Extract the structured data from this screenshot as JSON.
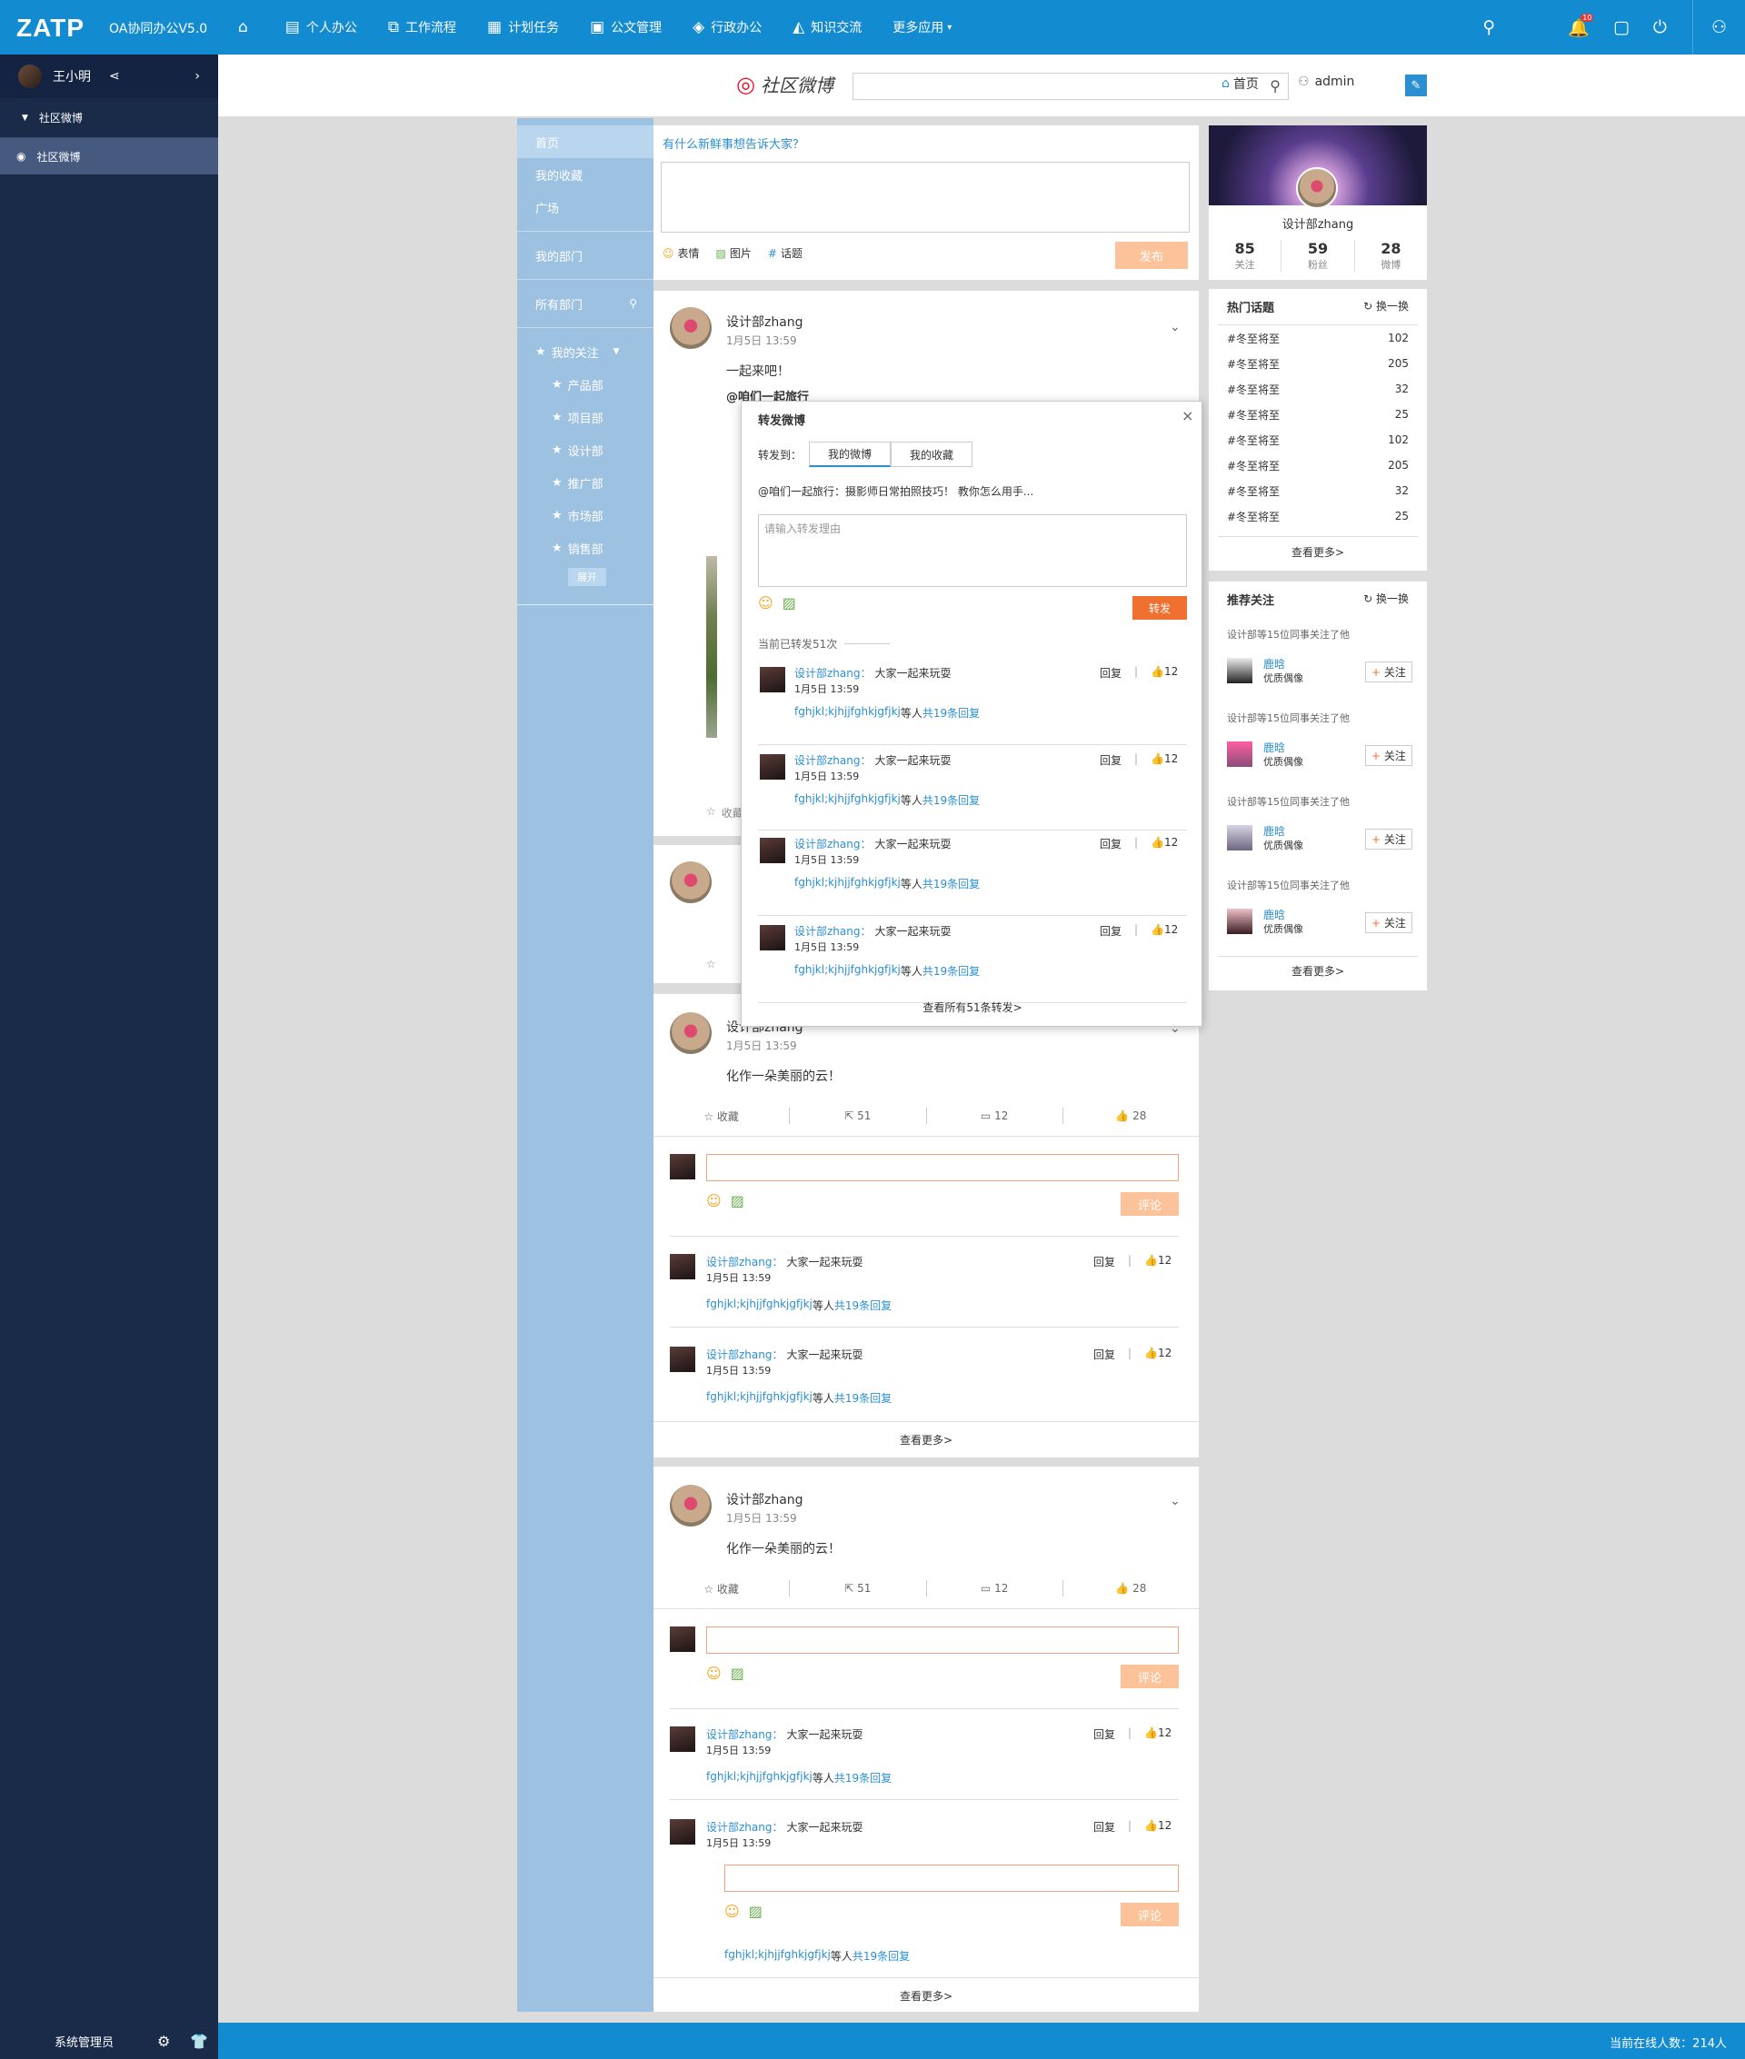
{
  "topbar": {
    "logo": "ZATP",
    "app_name": "OA协同办公V5.0",
    "nav": [
      {
        "label": "个人办公",
        "icon": "document-icon"
      },
      {
        "label": "工作流程",
        "icon": "flow-icon"
      },
      {
        "label": "计划任务",
        "icon": "task-icon"
      },
      {
        "label": "公文管理",
        "icon": "archive-icon"
      },
      {
        "label": "行政办公",
        "icon": "layers-icon"
      },
      {
        "label": "知识交流",
        "icon": "graduation-icon"
      }
    ],
    "more_apps": "更多应用",
    "notif_count": "10"
  },
  "sidebar": {
    "user_name": "王小明",
    "group": "社区微博",
    "item": "社区微博",
    "footer": "系统管理员"
  },
  "header": {
    "brand": "社区微博",
    "search_placeholder": "",
    "home": "首页",
    "user": "admin"
  },
  "leftnav": {
    "items": [
      "首页",
      "我的收藏",
      "广场"
    ],
    "my_dept": "我的部门",
    "all_dept": "所有部门",
    "my_follow": "我的关注",
    "sub_items": [
      "产品部",
      "项目部",
      "设计部",
      "推广部",
      "市场部",
      "销售部"
    ],
    "expand": "展开"
  },
  "composer": {
    "prompt": "有什么新鲜事想告诉大家？",
    "emoji": "表情",
    "image": "图片",
    "topic": "话题",
    "publish": "发布"
  },
  "profile": {
    "name": "设计部zhang",
    "stats": [
      {
        "value": "85",
        "label": "关注"
      },
      {
        "value": "59",
        "label": "粉丝"
      },
      {
        "value": "28",
        "label": "微博"
      }
    ]
  },
  "hot_topics": {
    "title": "热门话题",
    "refresh": "换一换",
    "items": [
      {
        "name": "#冬至将至",
        "count": "102"
      },
      {
        "name": "#冬至将至",
        "count": "205"
      },
      {
        "name": "#冬至将至",
        "count": "32"
      },
      {
        "name": "#冬至将至",
        "count": "25"
      },
      {
        "name": "#冬至将至",
        "count": "102"
      },
      {
        "name": "#冬至将至",
        "count": "205"
      },
      {
        "name": "#冬至将至",
        "count": "32"
      },
      {
        "name": "#冬至将至",
        "count": "25"
      }
    ],
    "more": "查看更多>"
  },
  "recommend": {
    "title": "推荐关注",
    "refresh": "换一换",
    "reason": "设计部等15位同事关注了他",
    "name": "鹿晗",
    "desc": "优质偶像",
    "follow": "关注",
    "more": "查看更多>"
  },
  "post1": {
    "author": "设计部zhang",
    "time": "1月5日  13:59",
    "text": "一起来吧！",
    "mention": "@咱们一起旅行",
    "fav": "收藏"
  },
  "post2": {
    "author": "设计部zhang",
    "time": "1月5日  13:59",
    "text": "化作一朵美丽的云！",
    "fav": "收藏",
    "share": "51",
    "comment": "12",
    "like": "28",
    "comment_btn": "评论",
    "more": "查看更多>"
  },
  "comment": {
    "author": "设计部zhang",
    "colon": "：",
    "text": "大家一起来玩耍",
    "time": "1月5日   13:59",
    "reply": "回复",
    "like": "12",
    "names": "fghjkl;kjhjjfghkjgfjkj",
    "mid": "等人",
    "count": "共19条回复"
  },
  "modal": {
    "title": "转发微博",
    "to_label": "转发到：",
    "tabs": [
      "我的微博",
      "我的收藏"
    ],
    "quote": "@咱们一起旅行：",
    "quote_text": "摄影师日常拍照技巧！ 教你怎么用手...",
    "placeholder": "请输入转发理由",
    "button": "转发",
    "count_text": "当前已转发51次",
    "view_all": "查看所有51条转发>"
  },
  "footer": {
    "online": "当前在线人数：214人"
  }
}
